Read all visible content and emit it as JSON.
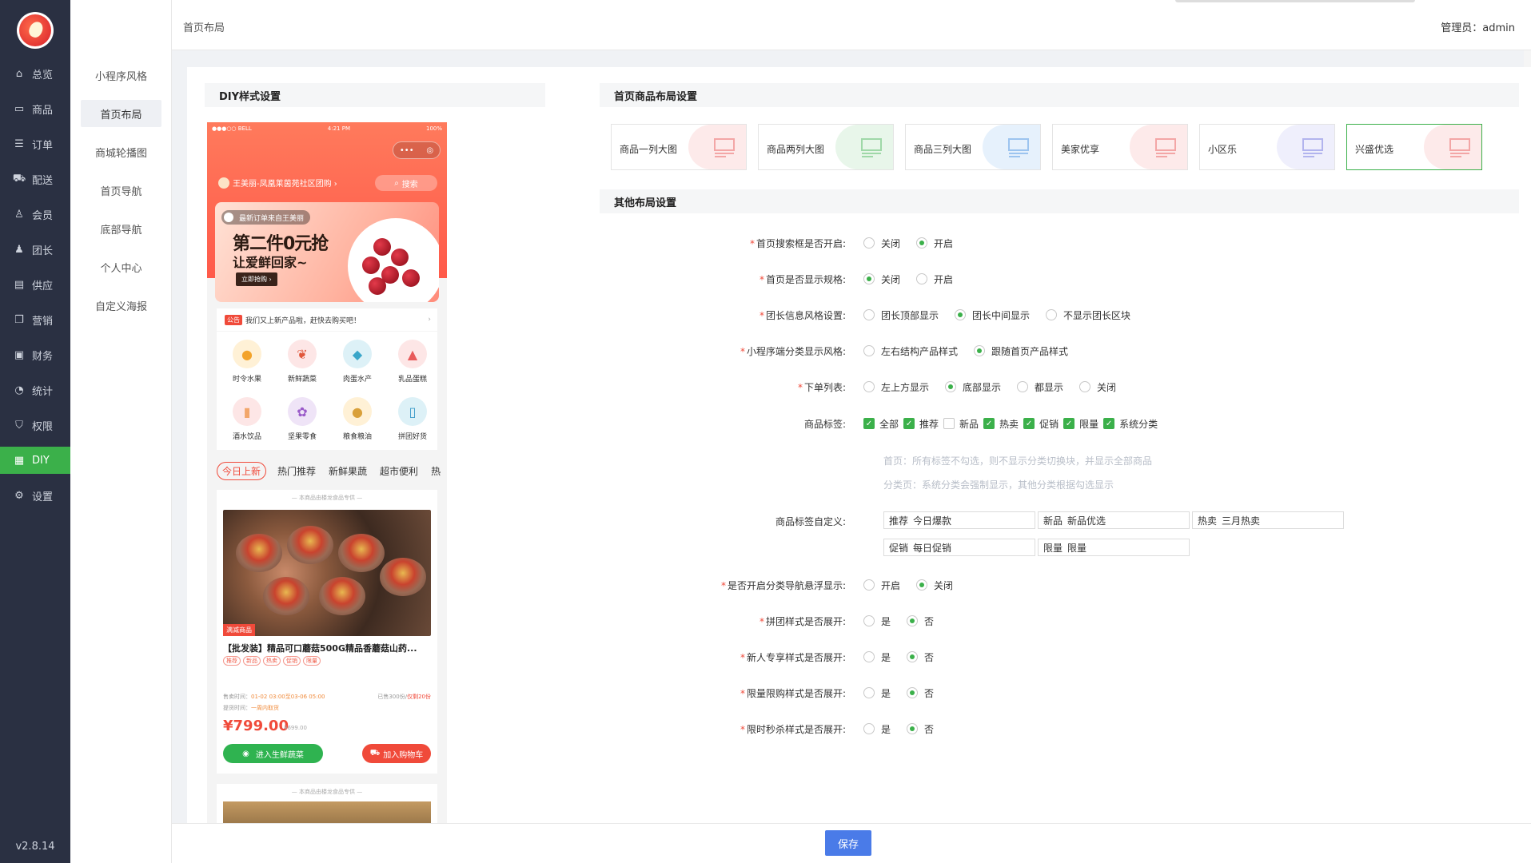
{
  "app": {
    "version": "v2.8.14",
    "admin_label": "管理员：",
    "admin_name": "admin"
  },
  "breadcrumb": "首页布局",
  "nav_main": [
    {
      "label": "总览",
      "icon": "home-icon"
    },
    {
      "label": "商品",
      "icon": "box-icon"
    },
    {
      "label": "订单",
      "icon": "order-icon"
    },
    {
      "label": "配送",
      "icon": "truck-icon"
    },
    {
      "label": "会员",
      "icon": "user-icon"
    },
    {
      "label": "团长",
      "icon": "leader-icon"
    },
    {
      "label": "供应",
      "icon": "supply-icon"
    },
    {
      "label": "营销",
      "icon": "gift-icon"
    },
    {
      "label": "财务",
      "icon": "finance-icon"
    },
    {
      "label": "统计",
      "icon": "chart-icon"
    },
    {
      "label": "权限",
      "icon": "shield-icon"
    },
    {
      "label": "DIY",
      "icon": "grid-icon"
    },
    {
      "label": "设置",
      "icon": "gear-icon"
    }
  ],
  "nav_sub": [
    "小程序风格",
    "首页布局",
    "商城轮播图",
    "首页导航",
    "底部导航",
    "个人中心",
    "自定义海报"
  ],
  "sections": {
    "diy": "DIY样式设置",
    "layout": "首页商品布局设置",
    "other": "其他布局设置"
  },
  "phone": {
    "status_left": "●●●○○ BELL",
    "status_time": "4:21 PM",
    "status_right": "100%",
    "capsule_dots": "•••",
    "capsule_target": "◎",
    "store_name": "王美丽-凤凰莱茵苑社区团购 ›",
    "search": "搜索",
    "banner_order": "最新订单来自王美丽",
    "banner_line1": "第二件0元抢",
    "banner_line2": "让爱鲜回家~",
    "banner_btn": "立即抢购 ›",
    "notice_tag": "公告",
    "notice_text": "我们又上新产品啦，赶快去购买吧！",
    "categories": [
      "时令水果",
      "新鲜蔬菜",
      "肉蛋水产",
      "乳品蛋糕",
      "酒水饮品",
      "坚果零食",
      "粮食粮油",
      "拼团好货"
    ],
    "tabs": [
      "今日上新",
      "热门推荐",
      "新鲜果蔬",
      "超市便利",
      "热"
    ],
    "card_hint": "— 本商品由楼龙食品专供 —",
    "card_img_label": "满减商品",
    "card_title": "【批发装】精品可口蘑菇500G精品香蘑菇山药...",
    "card_tags": [
      "推荐",
      "新品",
      "热卖",
      "促销",
      "限量"
    ],
    "sale_time_label": "售卖时间：",
    "sale_time": "01-02 03:00至03-06 05:00",
    "sold_label": "已售300份",
    "sold_remain": "仅剩20份",
    "pickup_label": "提货时间：",
    "pickup": "一周内取货",
    "price": "¥799.00",
    "orig_price": "¥699.00",
    "btn_group": "进入生鲜蔬菜",
    "btn_cart": "加入购物车",
    "card2_hint": "— 本商品由楼龙食品专供 —"
  },
  "layout_options": [
    {
      "label": "商品一列大图",
      "color": "#fdeaea",
      "glyph": "#f3a6a6"
    },
    {
      "label": "商品两列大图",
      "color": "#e8f6ea",
      "glyph": "#9fd8a8"
    },
    {
      "label": "商品三列大图",
      "color": "#e6f1fc",
      "glyph": "#9cc4ef"
    },
    {
      "label": "美家优享",
      "color": "#fdeaea",
      "glyph": "#f3a6a6"
    },
    {
      "label": "小区乐",
      "color": "#efeffc",
      "glyph": "#b2b4ee"
    },
    {
      "label": "兴盛优选",
      "color": "#fdeaea",
      "glyph": "#f3a6a6"
    }
  ],
  "form": {
    "search_open": {
      "label": "首页搜索框是否开启:",
      "options": [
        "关闭",
        "开启"
      ]
    },
    "show_spec": {
      "label": "首页是否显示规格:",
      "options": [
        "关闭",
        "开启"
      ]
    },
    "leader_style": {
      "label": "团长信息风格设置:",
      "options": [
        "团长顶部显示",
        "团长中间显示",
        "不显示团长区块"
      ]
    },
    "cat_style": {
      "label": "小程序端分类显示风格:",
      "options": [
        "左右结构产品样式",
        "跟随首页产品样式"
      ]
    },
    "order_list": {
      "label": "下单列表:",
      "options": [
        "左上方显示",
        "底部显示",
        "都显示",
        "关闭"
      ]
    },
    "tags": {
      "label": "商品标签:",
      "options": [
        "全部",
        "推荐",
        "新品",
        "热卖",
        "促销",
        "限量",
        "系统分类"
      ]
    },
    "hint1": "首页：所有标签不勾选，则不显示分类切换块，并显示全部商品",
    "hint2": "分类页：系统分类会强制显示，其他分类根据勾选显示",
    "tag_custom": {
      "label": "商品标签自定义:",
      "fields": [
        {
          "key": "推荐",
          "value": "今日爆款"
        },
        {
          "key": "新品",
          "value": "新品优选"
        },
        {
          "key": "热卖",
          "value": "三月热卖"
        },
        {
          "key": "促销",
          "value": "每日促销"
        },
        {
          "key": "限量",
          "value": "限量"
        }
      ]
    },
    "cat_float": {
      "label": "是否开启分类导航悬浮显示:",
      "options": [
        "开启",
        "关闭"
      ]
    },
    "group_expand": {
      "label": "拼团样式是否展开:",
      "options": [
        "是",
        "否"
      ]
    },
    "new_expand": {
      "label": "新人专享样式是否展开:",
      "options": [
        "是",
        "否"
      ]
    },
    "limit_expand": {
      "label": "限量限购样式是否展开:",
      "options": [
        "是",
        "否"
      ]
    },
    "flash_expand": {
      "label": "限时秒杀样式是否展开:",
      "options": [
        "是",
        "否"
      ]
    }
  },
  "save_label": "保存",
  "colors": {
    "accent": "#3bb04a",
    "primary_btn": "#4a7be8",
    "nav_bg": "#2a3042",
    "danger": "#f04a3a"
  }
}
